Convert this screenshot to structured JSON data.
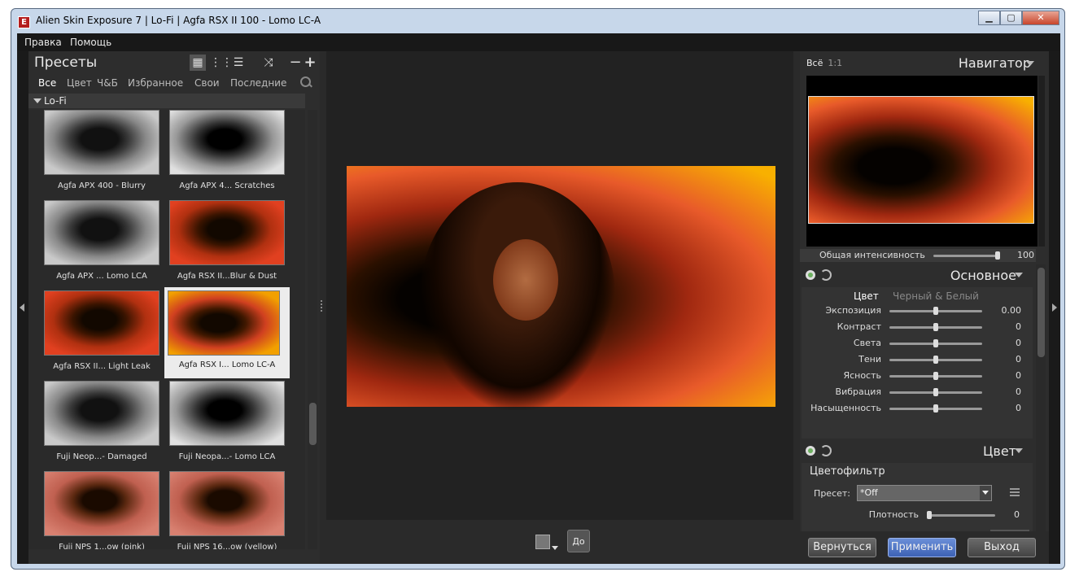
{
  "window": {
    "title": "Alien Skin Exposure 7 | Lo-Fi | Agfa RSX II 100 - Lomo LC-A",
    "minimize": "▁",
    "maximize": "▢",
    "close": "✕"
  },
  "menu": [
    "Правка",
    "Помощь"
  ],
  "presets": {
    "title": "Пресеты",
    "tabs": [
      "Все",
      "Цвет",
      "Ч&Б",
      "Избранное",
      "Свои",
      "Последние"
    ],
    "active_tab": "Все",
    "group": "Lo-Fi",
    "items": [
      {
        "label": "Agfa APX 400 - Blurry",
        "style": "bw"
      },
      {
        "label": "Agfa APX 4... Scratches",
        "style": "bw2"
      },
      {
        "label": "Agfa APX ... Lomo LCA",
        "style": "bw"
      },
      {
        "label": "Agfa RSX II...Blur & Dust",
        "style": "red"
      },
      {
        "label": "Agfa RSX II... Light Leak",
        "style": "red"
      },
      {
        "label": "Agfa RSX I... Lomo LC-A",
        "style": "warm",
        "selected": true
      },
      {
        "label": "Fuji Neop...- Damaged",
        "style": "bw"
      },
      {
        "label": "Fuji Neopa...- Lomo LCA",
        "style": "bw2"
      },
      {
        "label": "Fuji NPS 1...ow (pink)",
        "style": "pink"
      },
      {
        "label": "Fuji NPS 16...ow (yellow)",
        "style": "pink"
      }
    ]
  },
  "center": {
    "before_button": "До"
  },
  "navigator": {
    "zoom_all": "Всё",
    "zoom_1to1": "1:1",
    "title": "Навигатор",
    "intensity_label": "Общая интенсивность",
    "intensity_value": "100",
    "intensity_level": 1.0
  },
  "basic": {
    "title": "Основное",
    "mode_color": "Цвет",
    "mode_bw": "Черный & Белый",
    "rows": [
      {
        "label": "Экспозиция",
        "value": "0.00"
      },
      {
        "label": "Контраст",
        "value": "0"
      },
      {
        "label": "Света",
        "value": "0"
      },
      {
        "label": "Тени",
        "value": "0"
      },
      {
        "label": "Ясность",
        "value": "0"
      },
      {
        "label": "Вибрация",
        "value": "0"
      },
      {
        "label": "Насыщенность",
        "value": "0"
      }
    ]
  },
  "color": {
    "title": "Цвет",
    "filter_title": "Цветофильтр",
    "preset_label": "Пресет:",
    "preset_value": "*Off",
    "density_label": "Плотность",
    "density_value": "0"
  },
  "footer": {
    "revert": "Вернуться",
    "apply": "Применить",
    "exit": "Выход"
  }
}
